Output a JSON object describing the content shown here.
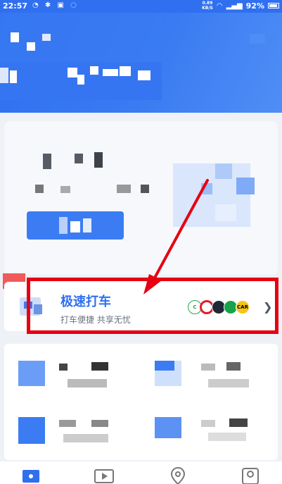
{
  "status_bar": {
    "time": "22:57",
    "net_speed_value": "0.89",
    "net_speed_unit": "KB/S",
    "battery": "92%"
  },
  "ride": {
    "title": "极速打车",
    "subtitle": "打车便捷  共享无忧",
    "accent_color": "#2f6ff0",
    "partner_logos": [
      "C",
      "",
      "",
      "",
      "CAR"
    ]
  },
  "annotation": {
    "color": "#e60012"
  },
  "bottom_nav": {
    "items": [
      "ticket-icon",
      "video-icon",
      "location-icon",
      "profile-icon"
    ]
  }
}
